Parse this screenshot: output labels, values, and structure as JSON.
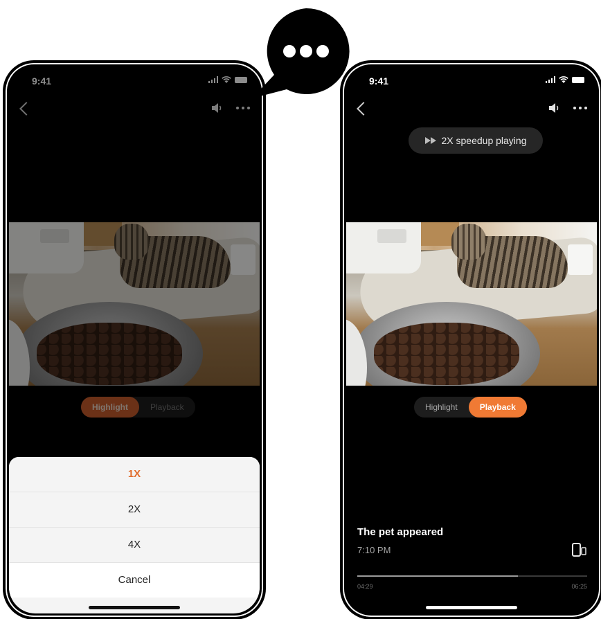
{
  "status_bar": {
    "time": "9:41"
  },
  "left_screen": {
    "tabs": [
      {
        "label": "Highlight",
        "active": true
      },
      {
        "label": "Playback",
        "active": false
      }
    ],
    "speed_sheet": {
      "options": [
        {
          "label": "1X",
          "selected": true
        },
        {
          "label": "2X",
          "selected": false
        },
        {
          "label": "4X",
          "selected": false
        }
      ],
      "cancel_label": "Cancel"
    }
  },
  "right_screen": {
    "toast": {
      "text": "2X speedup playing",
      "icon": "fast-forward-icon"
    },
    "tabs": [
      {
        "label": "Highlight",
        "active": false
      },
      {
        "label": "Playback",
        "active": true
      }
    ],
    "event": {
      "title": "The pet appeared",
      "time": "7:10 PM"
    },
    "progress": {
      "current": "04:29",
      "total": "06:25",
      "fraction": 0.7
    }
  },
  "callout": {
    "icon": "more-dots-icon"
  },
  "colors": {
    "accent_active": "#f07a34",
    "accent_dimmed": "#c45a2b",
    "selected_option": "#e06c2c"
  }
}
